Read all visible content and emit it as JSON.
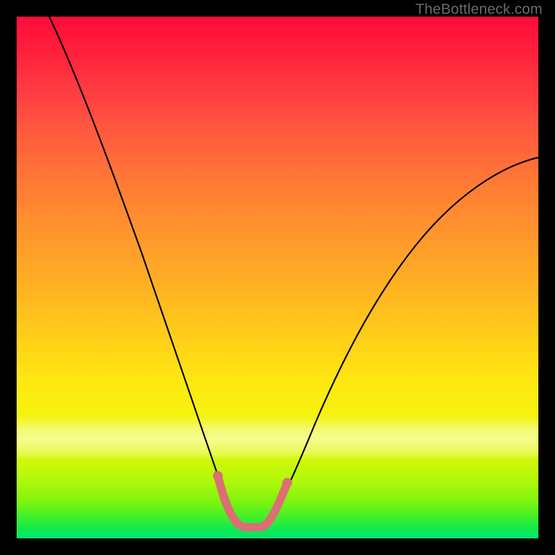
{
  "watermark": {
    "text": "TheBottleneck.com"
  },
  "colors": {
    "background": "#000000",
    "curve_stroke": "#000000",
    "pink_stroke": "#db6f74",
    "gradient_stops": [
      "#ff0b3c",
      "#ffb222",
      "#fee812",
      "#0aea53",
      "#05e576"
    ]
  },
  "chart_data": {
    "type": "line",
    "title": "",
    "xlabel": "",
    "ylabel": "",
    "xlim": [
      0,
      100
    ],
    "ylim": [
      0,
      100
    ],
    "grid": false,
    "legend": false,
    "series": [
      {
        "name": "bottleneck-curve",
        "x": [
          5,
          8,
          12,
          16,
          20,
          24,
          28,
          32,
          34,
          36,
          38,
          40,
          41,
          42,
          43,
          44,
          45,
          46,
          48,
          50,
          52,
          55,
          60,
          65,
          70,
          75,
          82,
          90,
          100
        ],
        "y": [
          100,
          90,
          78,
          67,
          56,
          46,
          36,
          26,
          21,
          16,
          11,
          6,
          4,
          2,
          1,
          1,
          2,
          4,
          8,
          12,
          16,
          21,
          30,
          38,
          45,
          51,
          58,
          64,
          70
        ]
      },
      {
        "name": "optimal-pink-segment",
        "x": [
          38.5,
          39.5,
          40.5,
          41.5,
          42.5,
          43.5,
          44.5,
          45.5,
          46.5,
          47.0
        ],
        "y": [
          8,
          5,
          3,
          2,
          1.3,
          1.3,
          2,
          3.5,
          6,
          8
        ]
      }
    ],
    "note": "Percent axes inferred; V-shaped bottleneck curve with minimum near x≈43 on a red→green vertical gradient. Pink segment marks the near-optimal trough."
  }
}
